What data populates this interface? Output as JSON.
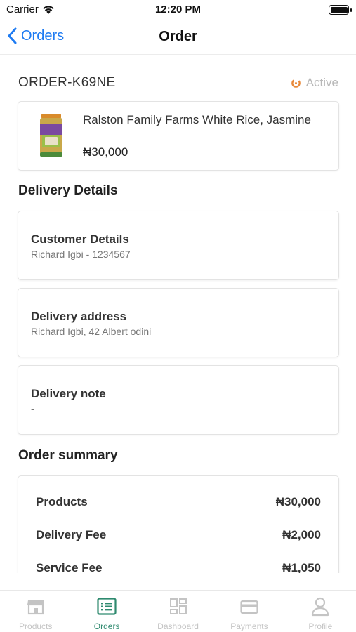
{
  "status_bar": {
    "carrier": "Carrier",
    "time": "12:20 PM"
  },
  "nav": {
    "back_label": "Orders",
    "title": "Order"
  },
  "order": {
    "id": "ORDER-K69NE",
    "status": "Active"
  },
  "product": {
    "name": "Ralston Family Farms White Rice, Jasmine",
    "price": "₦30,000"
  },
  "delivery": {
    "section_title": "Delivery Details",
    "customer": {
      "label": "Customer Details",
      "value": "Richard Igbi - 1234567"
    },
    "address": {
      "label": "Delivery address",
      "value": "Richard Igbi, 42 Albert odini"
    },
    "note": {
      "label": "Delivery note",
      "value": "-"
    }
  },
  "summary": {
    "section_title": "Order summary",
    "rows": [
      {
        "label": "Products",
        "value": "₦30,000"
      },
      {
        "label": "Delivery Fee",
        "value": "₦2,000"
      },
      {
        "label": "Service Fee",
        "value": "₦1,050"
      }
    ]
  },
  "tabs": [
    {
      "label": "Products",
      "icon": "store-icon"
    },
    {
      "label": "Orders",
      "icon": "list-icon"
    },
    {
      "label": "Dashboard",
      "icon": "dashboard-icon"
    },
    {
      "label": "Payments",
      "icon": "card-icon"
    },
    {
      "label": "Profile",
      "icon": "person-icon"
    }
  ],
  "colors": {
    "accent": "#1e7bf2",
    "active_tab": "#2f8a6f",
    "status_icon": "#e8893a",
    "inactive": "#c4c4c4"
  }
}
